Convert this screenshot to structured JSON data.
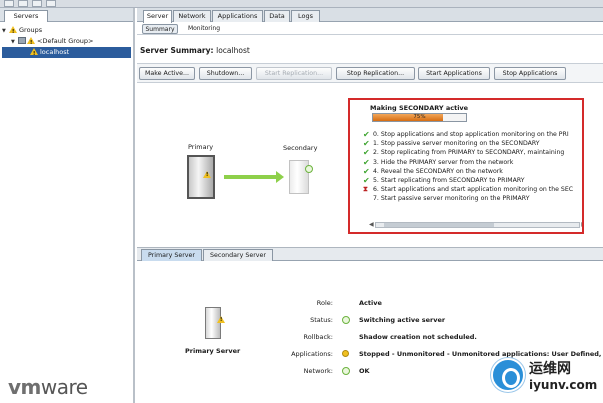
{
  "left": {
    "tab": "Servers",
    "tree": [
      {
        "label": "Groups"
      },
      {
        "label": "<Default Group>"
      },
      {
        "label": "localhost"
      }
    ],
    "logo": "vmware"
  },
  "main": {
    "tabs": [
      "Server",
      "Network",
      "Applications",
      "Data",
      "Logs"
    ],
    "subtabs": [
      "Summary",
      "Monitoring"
    ],
    "summary_title": "Server Summary:",
    "summary_host": "localhost",
    "actions": [
      {
        "label": "Make Active...",
        "enabled": true
      },
      {
        "label": "Shutdown...",
        "enabled": true
      },
      {
        "label": "Start Replication...",
        "enabled": false
      },
      {
        "label": "Stop Replication...",
        "enabled": true
      },
      {
        "label": "Start Applications",
        "enabled": true
      },
      {
        "label": "Stop Applications",
        "enabled": true
      }
    ],
    "diagram": {
      "primary": "Primary",
      "secondary": "Secondary"
    },
    "progress": {
      "title": "Making SECONDARY active",
      "percent": 75,
      "percent_label": "75%",
      "steps": [
        {
          "text": "0. Stop applications and stop application monitoring on the PRI",
          "state": "done"
        },
        {
          "text": "1. Stop passive server monitoring on the SECONDARY",
          "state": "done"
        },
        {
          "text": "2. Stop replicating from PRIMARY to SECONDARY, maintaining",
          "state": "done"
        },
        {
          "text": "3. Hide the PRIMARY server from the network",
          "state": "done"
        },
        {
          "text": "4. Reveal the SECONDARY on the network",
          "state": "done"
        },
        {
          "text": "5. Start replicating from SECONDARY to PRIMARY",
          "state": "done"
        },
        {
          "text": "6. Start applications and start application monitoring on the SEC",
          "state": "running"
        },
        {
          "text": "7. Start passive server monitoring on the PRIMARY",
          "state": "pending"
        }
      ]
    },
    "lower_tabs": [
      "Primary Server",
      "Secondary Server"
    ],
    "primary_label": "Primary Server",
    "props": [
      {
        "label": "Role:",
        "value": "Active",
        "icon": ""
      },
      {
        "label": "Status:",
        "value": "Switching active server",
        "icon": "ok-icon"
      },
      {
        "label": "Rollback:",
        "value": "Shadow creation not scheduled.",
        "icon": ""
      },
      {
        "label": "Applications:",
        "value": "Stopped - Unmonitored - Unmonitored applications: User Defined, VI",
        "icon": "warning-icon"
      },
      {
        "label": "Network:",
        "value": "OK",
        "icon": "ok-icon"
      }
    ]
  },
  "watermark": {
    "cn": "运维网",
    "site": "iyunv.com"
  }
}
